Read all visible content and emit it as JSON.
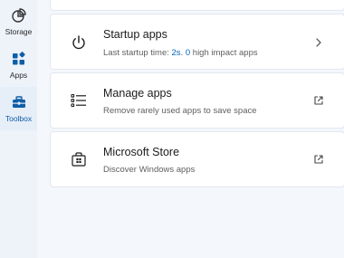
{
  "sidebar": {
    "items": [
      {
        "label": "Storage",
        "icon": "pie-chart-icon",
        "active": false
      },
      {
        "label": "Apps",
        "icon": "apps-icon",
        "active": false
      },
      {
        "label": "Toolbox",
        "icon": "toolbox-icon",
        "active": true
      }
    ]
  },
  "cards": {
    "startup": {
      "title": "Startup apps",
      "sub_prefix": "Last startup time: ",
      "time_value": "2s",
      "sub_middle": ". ",
      "impact_count": "0",
      "sub_suffix": " high impact apps",
      "icon": "power-icon",
      "action_icon": "chevron-right-icon"
    },
    "manage": {
      "title": "Manage apps",
      "subtitle": "Remove rarely used apps to save space",
      "icon": "list-icon",
      "action_icon": "external-link-icon"
    },
    "store": {
      "title": "Microsoft Store",
      "subtitle": "Discover Windows apps",
      "icon": "store-icon",
      "action_icon": "external-link-icon"
    }
  },
  "colors": {
    "accent": "#0067c0",
    "active_label": "#0f5ea8",
    "background": "#f4f7fc",
    "card": "#ffffff"
  }
}
